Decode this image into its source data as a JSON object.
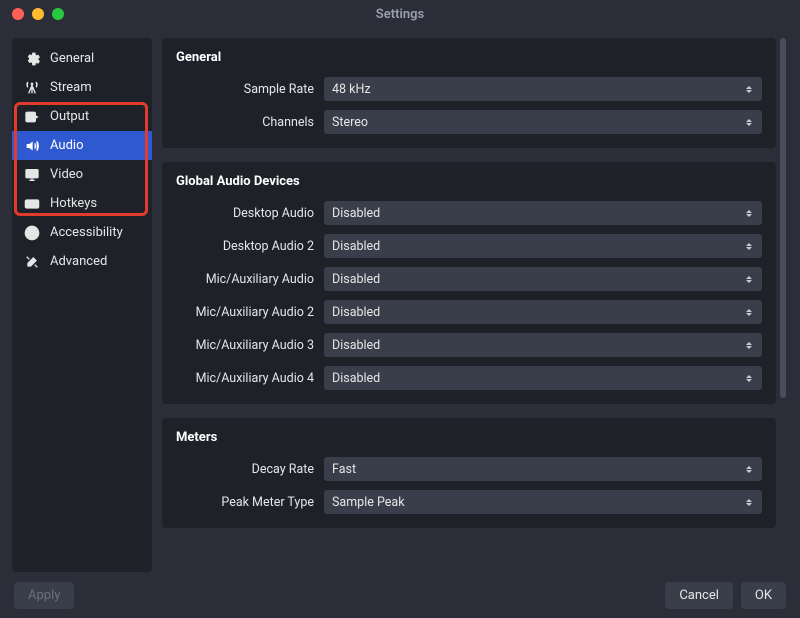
{
  "window": {
    "title": "Settings"
  },
  "sidebar": {
    "items": [
      {
        "label": "General",
        "icon": "gear-icon"
      },
      {
        "label": "Stream",
        "icon": "antenna-icon"
      },
      {
        "label": "Output",
        "icon": "output-icon"
      },
      {
        "label": "Audio",
        "icon": "speaker-icon"
      },
      {
        "label": "Video",
        "icon": "monitor-icon"
      },
      {
        "label": "Hotkeys",
        "icon": "keyboard-icon"
      },
      {
        "label": "Accessibility",
        "icon": "accessibility-icon"
      },
      {
        "label": "Advanced",
        "icon": "tools-icon"
      }
    ],
    "selected_index": 3,
    "highlight_indices": [
      2,
      3,
      4
    ]
  },
  "sections": {
    "general": {
      "title": "General",
      "fields": {
        "sample_rate": {
          "label": "Sample Rate",
          "value": "48 kHz"
        },
        "channels": {
          "label": "Channels",
          "value": "Stereo"
        }
      }
    },
    "global_audio": {
      "title": "Global Audio Devices",
      "fields": {
        "desktop1": {
          "label": "Desktop Audio",
          "value": "Disabled"
        },
        "desktop2": {
          "label": "Desktop Audio 2",
          "value": "Disabled"
        },
        "mic1": {
          "label": "Mic/Auxiliary Audio",
          "value": "Disabled"
        },
        "mic2": {
          "label": "Mic/Auxiliary Audio 2",
          "value": "Disabled"
        },
        "mic3": {
          "label": "Mic/Auxiliary Audio 3",
          "value": "Disabled"
        },
        "mic4": {
          "label": "Mic/Auxiliary Audio 4",
          "value": "Disabled"
        }
      }
    },
    "meters": {
      "title": "Meters",
      "fields": {
        "decay": {
          "label": "Decay Rate",
          "value": "Fast"
        },
        "peak_type": {
          "label": "Peak Meter Type",
          "value": "Sample Peak"
        }
      }
    }
  },
  "footer": {
    "apply": "Apply",
    "cancel": "Cancel",
    "ok": "OK"
  }
}
